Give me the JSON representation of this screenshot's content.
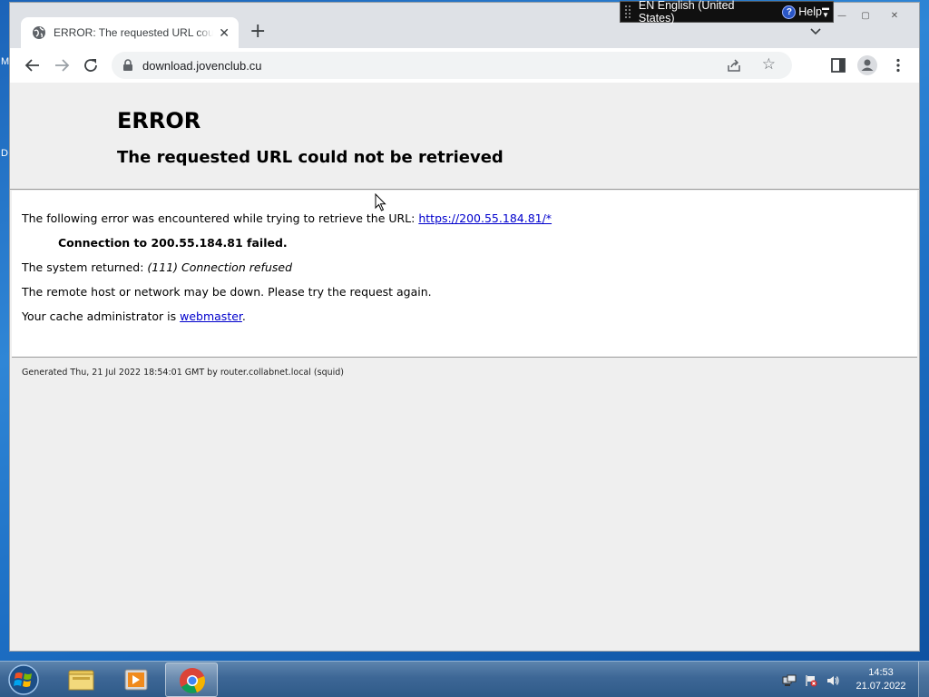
{
  "desktop": {
    "label_top": "M",
    "label_mid": "D"
  },
  "language_bar": {
    "language": "EN English (United States)",
    "help_label": "Help",
    "help_icon_glyph": "?"
  },
  "browser": {
    "tab": {
      "title": "ERROR: The requested URL could not be retrieved",
      "close_glyph": "✕",
      "favicon": "globe-icon"
    },
    "new_tab_glyph": "+",
    "window_controls": {
      "minimize": "—",
      "maximize": "▢",
      "close": "✕"
    },
    "address": {
      "url": "download.jovenclub.cu"
    }
  },
  "page": {
    "heading": "ERROR",
    "subheading": "The requested URL could not be retrieved",
    "line1_text": "The following error was encountered while trying to retrieve the URL: ",
    "line1_link": "https://200.55.184.81/*",
    "line2": "Connection to 200.55.184.81 failed.",
    "line3_text": "The system returned: ",
    "line3_italic": "(111) Connection refused",
    "line4": "The remote host or network may be down. Please try the request again.",
    "line5_text": "Your cache administrator is ",
    "line5_link": "webmaster",
    "line5_end": ".",
    "footer": "Generated Thu, 21 Jul 2022 18:54:01 GMT by router.collabnet.local (squid)"
  },
  "taskbar": {
    "clock_time": "14:53",
    "clock_date": "21.07.2022",
    "pinned": [
      "windows-explorer",
      "media-player",
      "google-chrome"
    ]
  },
  "colors": {
    "link": "#0000cc",
    "page_bg": "#efefef",
    "taskbar": "#3d6796"
  }
}
